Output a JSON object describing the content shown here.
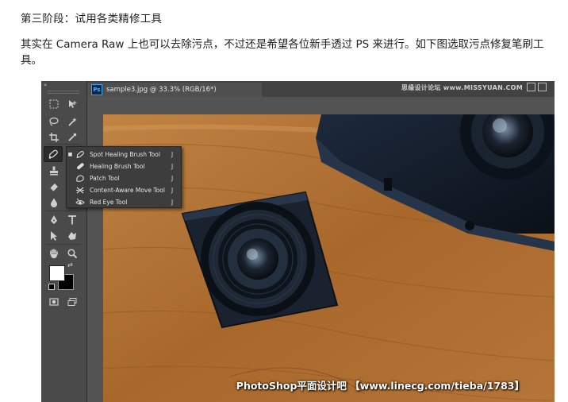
{
  "article": {
    "heading": "第三阶段：试用各类精修工具",
    "paragraph": "其实在 Camera Raw 上也可以去除污点，不过还是希望各位新手透过 PS 来进行。如下图选取污点修复笔刷工具。"
  },
  "photoshop": {
    "collapse_glyph": "«",
    "document_tab": {
      "icon": "Ps",
      "title": "sample3.jpg @ 33.3% (RGB/16*)"
    },
    "top_watermark": "思缘设计论坛  www.MISSYUAN.COM",
    "bottom_watermark": "PhotoShop平面设计吧 【www.linecg.com/tieba/1783】",
    "flyout_menu": [
      {
        "label": "Spot Healing Brush Tool",
        "shortcut": "J",
        "selected": true,
        "icon": "spot-healing-brush-icon"
      },
      {
        "label": "Healing Brush Tool",
        "shortcut": "J",
        "selected": false,
        "icon": "healing-brush-icon"
      },
      {
        "label": "Patch Tool",
        "shortcut": "J",
        "selected": false,
        "icon": "patch-icon"
      },
      {
        "label": "Content-Aware Move Tool",
        "shortcut": "J",
        "selected": false,
        "icon": "content-aware-move-icon"
      },
      {
        "label": "Red Eye Tool",
        "shortcut": "J",
        "selected": false,
        "icon": "red-eye-icon"
      }
    ],
    "colors": {
      "foreground": "#ffffff",
      "background": "#000000",
      "ui_dark": "#4a4a4a",
      "menu_bg": "#3d3d3d"
    }
  }
}
